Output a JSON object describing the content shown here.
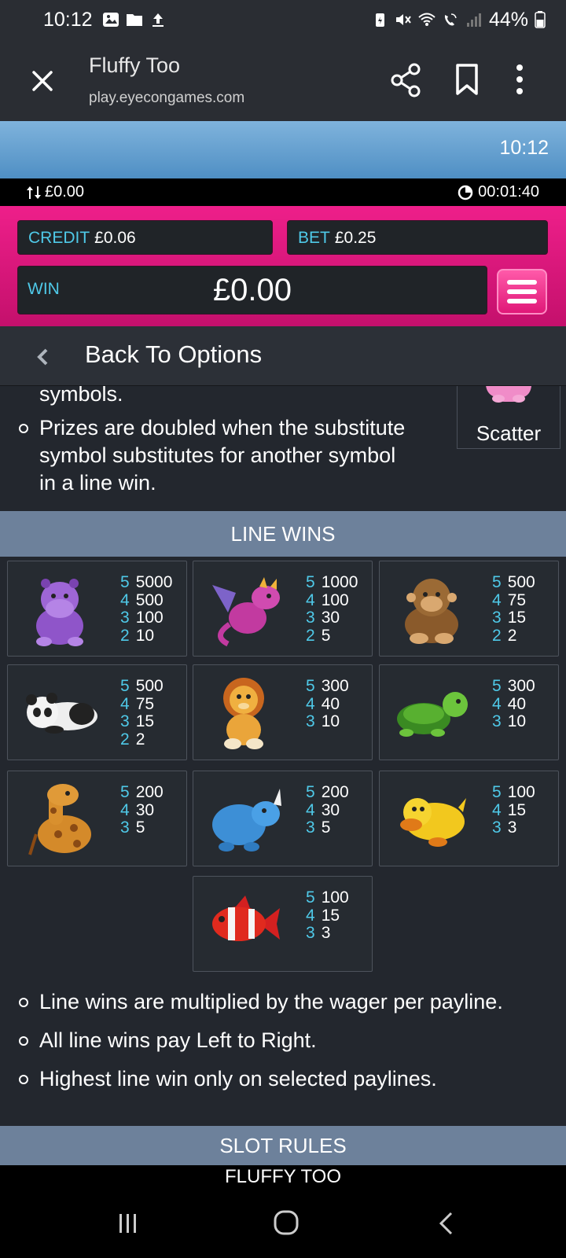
{
  "status_bar": {
    "time": "10:12",
    "battery": "44%",
    "left_icons": [
      "gallery-icon",
      "folder-icon",
      "upload-icon"
    ],
    "right_icons": [
      "battery-saver-icon",
      "mute-icon",
      "wifi-icon",
      "wifi-calling-icon",
      "signal-icon",
      "battery-icon"
    ]
  },
  "browser": {
    "title": "Fluffy Too",
    "url": "play.eyecongames.com"
  },
  "game_header": {
    "clock": "10:12",
    "balance_change": "£0.00",
    "session_time": "00:01:40",
    "credit_label": "CREDIT",
    "credit_value": "£0.06",
    "bet_label": "BET",
    "bet_value": "£0.25",
    "win_label": "WIN",
    "win_value": "£0.00"
  },
  "back_bar": {
    "label": "Back To Options"
  },
  "help": {
    "partial_text": "symbols.",
    "bullet_substitute": "Prizes are doubled when the substitute symbol substitutes for another symbol in a line win.",
    "bullet_substitute_lines": [
      "Prizes are doubled when the substitute",
      "symbol substitutes for another symbol",
      "in a line win."
    ],
    "scatter_label": "Scatter",
    "line_wins_title": "LINE WINS",
    "symbols": [
      {
        "name": "hippo",
        "pays": [
          {
            "n": "5",
            "v": "5000"
          },
          {
            "n": "4",
            "v": "500"
          },
          {
            "n": "3",
            "v": "100"
          },
          {
            "n": "2",
            "v": "10"
          }
        ]
      },
      {
        "name": "dragon",
        "pays": [
          {
            "n": "5",
            "v": "1000"
          },
          {
            "n": "4",
            "v": "100"
          },
          {
            "n": "3",
            "v": "30"
          },
          {
            "n": "2",
            "v": "5"
          }
        ]
      },
      {
        "name": "monkey",
        "pays": [
          {
            "n": "5",
            "v": "500"
          },
          {
            "n": "4",
            "v": "75"
          },
          {
            "n": "3",
            "v": "15"
          },
          {
            "n": "2",
            "v": "2"
          }
        ]
      },
      {
        "name": "panda",
        "pays": [
          {
            "n": "5",
            "v": "500"
          },
          {
            "n": "4",
            "v": "75"
          },
          {
            "n": "3",
            "v": "15"
          },
          {
            "n": "2",
            "v": "2"
          }
        ]
      },
      {
        "name": "lion",
        "pays": [
          {
            "n": "5",
            "v": "300"
          },
          {
            "n": "4",
            "v": "40"
          },
          {
            "n": "3",
            "v": "10"
          }
        ]
      },
      {
        "name": "turtle",
        "pays": [
          {
            "n": "5",
            "v": "300"
          },
          {
            "n": "4",
            "v": "40"
          },
          {
            "n": "3",
            "v": "10"
          }
        ]
      },
      {
        "name": "giraffe",
        "pays": [
          {
            "n": "5",
            "v": "200"
          },
          {
            "n": "4",
            "v": "30"
          },
          {
            "n": "3",
            "v": "5"
          }
        ]
      },
      {
        "name": "rhino",
        "pays": [
          {
            "n": "5",
            "v": "200"
          },
          {
            "n": "4",
            "v": "30"
          },
          {
            "n": "3",
            "v": "5"
          }
        ]
      },
      {
        "name": "duck",
        "pays": [
          {
            "n": "5",
            "v": "100"
          },
          {
            "n": "4",
            "v": "15"
          },
          {
            "n": "3",
            "v": "3"
          }
        ]
      },
      {
        "name": "clownfish",
        "pays": [
          {
            "n": "5",
            "v": "100"
          },
          {
            "n": "4",
            "v": "15"
          },
          {
            "n": "3",
            "v": "3"
          }
        ]
      }
    ],
    "rules": [
      "Line wins are multiplied by the wager per payline.",
      "All line wins pay Left to Right.",
      "Highest line win only on selected paylines."
    ],
    "slot_rules_title": "SLOT RULES",
    "game_name": "FLUFFY TOO"
  },
  "colors": {
    "accent_cyan": "#4fc9e8",
    "pink_panel": "#e0157d",
    "section_header": "#6d819b"
  }
}
